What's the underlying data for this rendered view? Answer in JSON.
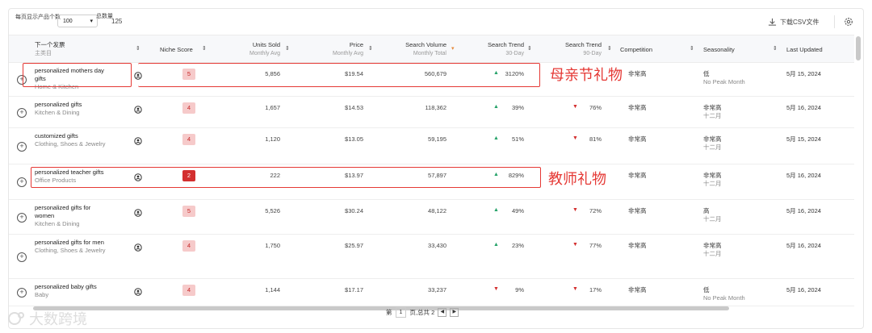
{
  "toolbar": {
    "per_page_label": "每页显示产品个数",
    "per_page_value": "100",
    "total_label": "总数量",
    "total_value": "125",
    "download_label": "下载CSV文件"
  },
  "columns": {
    "next_niche": "下一个发票",
    "main_category": "主类目",
    "niche_score": "Niche Score",
    "units_sold": "Units Sold",
    "units_sold_sub": "Monthly Avg",
    "price": "Price",
    "price_sub": "Monthly Avg",
    "search_volume": "Search Volume",
    "search_volume_sub": "Monthly Total",
    "trend30": "Search Trend",
    "trend30_sub": "30-Day",
    "trend90": "Search Trend",
    "trend90_sub": "90-Day",
    "competition": "Competition",
    "seasonality": "Seasonality",
    "last_updated": "Last Updated"
  },
  "rows": [
    {
      "name": "personalized mothers day gifts",
      "category": "Home & Kitchen",
      "score": "5",
      "units": "5,856",
      "price": "$19.54",
      "volume": "560,679",
      "t30": "3120%",
      "t30_dir": "up",
      "t90": "",
      "t90_dir": "",
      "competition": "非常高",
      "season": "低",
      "season_sub": "No Peak Month",
      "updated": "5月 15, 2024"
    },
    {
      "name": "personalized gifts",
      "category": "Kitchen & Dining",
      "score": "4",
      "units": "1,657",
      "price": "$14.53",
      "volume": "118,362",
      "t30": "39%",
      "t30_dir": "up",
      "t90": "76%",
      "t90_dir": "down",
      "competition": "非常高",
      "season": "非常高",
      "season_sub": "十二月",
      "updated": "5月 16, 2024"
    },
    {
      "name": "customized gifts",
      "category": "Clothing, Shoes & Jewelry",
      "score": "4",
      "units": "1,120",
      "price": "$13.05",
      "volume": "59,195",
      "t30": "51%",
      "t30_dir": "up",
      "t90": "81%",
      "t90_dir": "down",
      "competition": "非常高",
      "season": "非常高",
      "season_sub": "十二月",
      "updated": "5月 15, 2024"
    },
    {
      "name": "personalized teacher gifts",
      "category": "Office Products",
      "score": "2",
      "units": "222",
      "price": "$13.97",
      "volume": "57,897",
      "t30": "829%",
      "t30_dir": "up",
      "t90": "",
      "t90_dir": "",
      "competition": "非常高",
      "season": "非常高",
      "season_sub": "十二月",
      "updated": "5月 16, 2024"
    },
    {
      "name": "personalized gifts for women",
      "category": "Kitchen & Dining",
      "score": "5",
      "units": "5,526",
      "price": "$30.24",
      "volume": "48,122",
      "t30": "49%",
      "t30_dir": "up",
      "t90": "72%",
      "t90_dir": "down",
      "competition": "非常高",
      "season": "高",
      "season_sub": "十二月",
      "updated": "5月 16, 2024"
    },
    {
      "name": "personalized gifts for men",
      "category": "Clothing, Shoes & Jewelry",
      "score": "4",
      "units": "1,750",
      "price": "$25.97",
      "volume": "33,430",
      "t30": "23%",
      "t30_dir": "up",
      "t90": "77%",
      "t90_dir": "down",
      "competition": "非常高",
      "season": "非常高",
      "season_sub": "十二月",
      "updated": "5月 16, 2024"
    },
    {
      "name": "personalized baby gifts",
      "category": "Baby",
      "score": "4",
      "units": "1,144",
      "price": "$17.17",
      "volume": "33,237",
      "t30": "9%",
      "t30_dir": "down",
      "t90": "17%",
      "t90_dir": "down",
      "competition": "非常高",
      "season": "低",
      "season_sub": "No Peak Month",
      "updated": "5月 16, 2024"
    }
  ],
  "annotations": {
    "mothers_day": "母亲节礼物",
    "teacher": "教师礼物"
  },
  "pager": {
    "prefix": "第",
    "page": "1",
    "mid": "页,总共 2"
  },
  "watermark": "大数跨境",
  "icons": {
    "expand": "plus-circle-icon",
    "pin": "pin-icon",
    "download": "download-icon",
    "settings": "gear-icon"
  },
  "colors": {
    "up": "#26a269",
    "down": "#d32f2f",
    "highlight": "#e53935"
  }
}
